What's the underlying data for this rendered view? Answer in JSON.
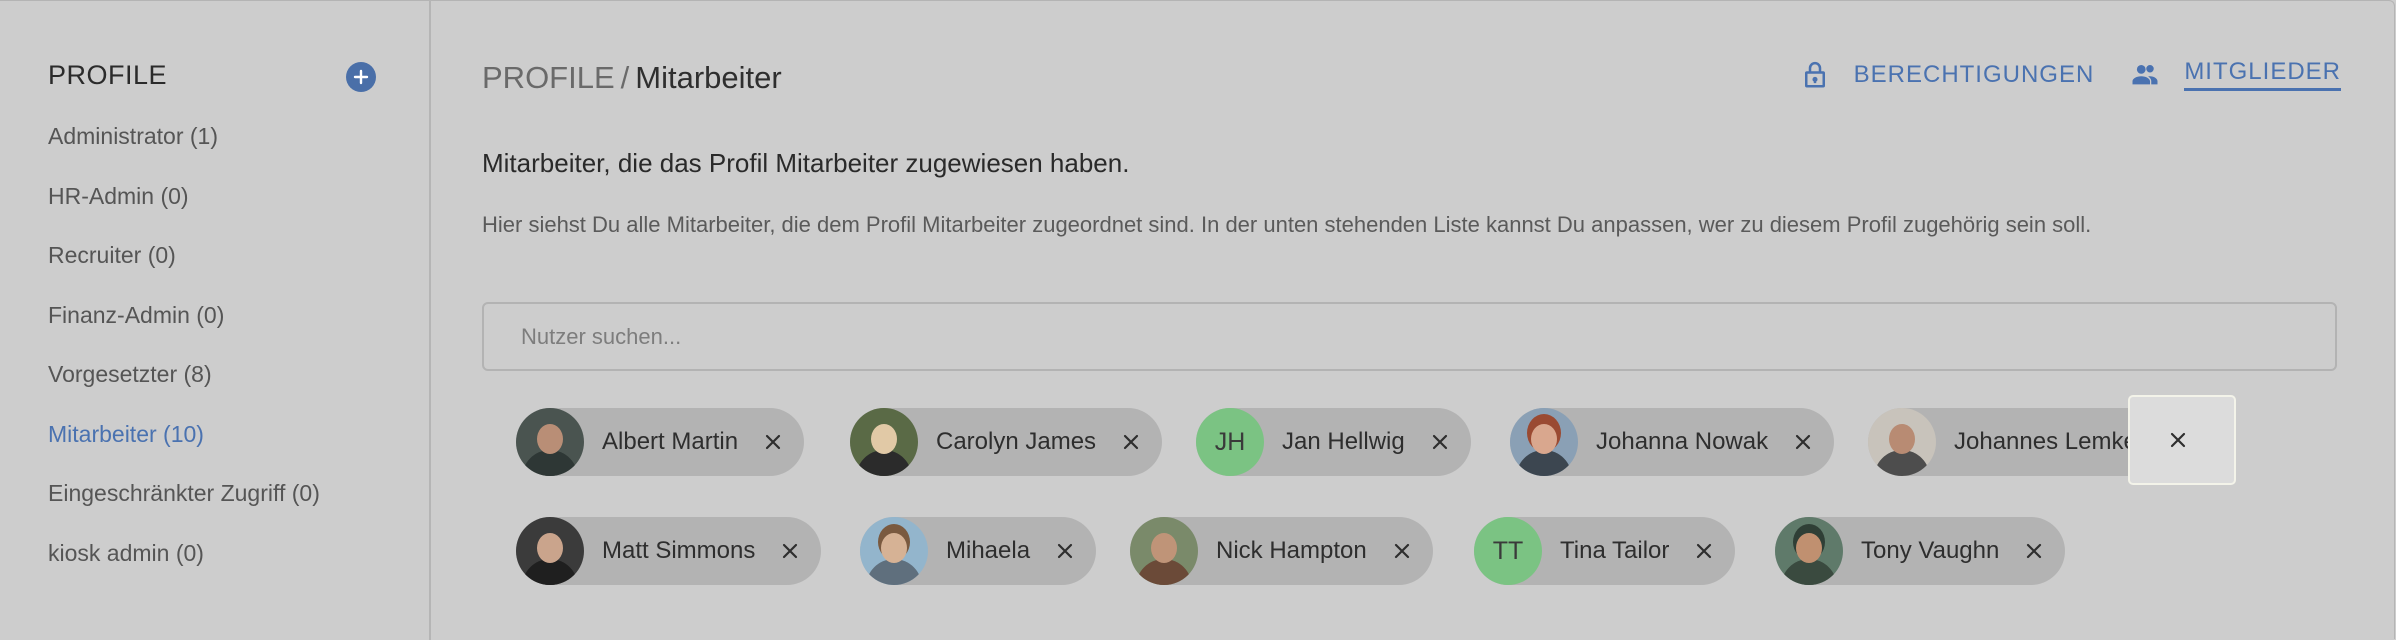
{
  "sidebar": {
    "title": "PROFILE",
    "items": [
      {
        "label": "Administrator (1)",
        "active": false
      },
      {
        "label": "HR-Admin (0)",
        "active": false
      },
      {
        "label": "Recruiter (0)",
        "active": false
      },
      {
        "label": "Finanz-Admin (0)",
        "active": false
      },
      {
        "label": "Vorgesetzter (8)",
        "active": false
      },
      {
        "label": "Mitarbeiter (10)",
        "active": true
      },
      {
        "label": "Eingeschränkter Zugriff (0)",
        "active": false
      },
      {
        "label": "kiosk admin (0)",
        "active": false
      }
    ]
  },
  "header": {
    "breadcrumb_root": "PROFILE",
    "breadcrumb_sep": "/",
    "breadcrumb_current": "Mitarbeiter",
    "permissions_label": "BERECHTIGUNGEN",
    "members_label": "MITGLIEDER"
  },
  "main": {
    "subtitle": "Mitarbeiter, die das Profil Mitarbeiter zugewiesen haben.",
    "description": "Hier siehst Du alle Mitarbeiter, die dem Profil Mitarbeiter zugeordnet sind. In der unten stehenden Liste kannst Du anpassen, wer zu diesem Profil zugehörig sein soll.",
    "search_placeholder": "Nutzer suchen..."
  },
  "members": [
    {
      "name": "Albert Martin",
      "avatar": "photo",
      "initials": ""
    },
    {
      "name": "Carolyn James",
      "avatar": "photo",
      "initials": ""
    },
    {
      "name": "Jan Hellwig",
      "avatar": "initials",
      "initials": "JH"
    },
    {
      "name": "Johanna Nowak",
      "avatar": "photo",
      "initials": ""
    },
    {
      "name": "Johannes Lemke",
      "avatar": "photo",
      "initials": ""
    },
    {
      "name": "Matt Simmons",
      "avatar": "photo",
      "initials": ""
    },
    {
      "name": "Mihaela",
      "avatar": "photo",
      "initials": ""
    },
    {
      "name": "Nick Hampton",
      "avatar": "photo",
      "initials": ""
    },
    {
      "name": "Tina Tailor",
      "avatar": "initials",
      "initials": "TT"
    },
    {
      "name": "Tony Vaughn",
      "avatar": "photo",
      "initials": ""
    }
  ],
  "colors": {
    "accent": "#4a72b0",
    "background": "#cdcdcd",
    "chip": "#b3b3b3",
    "initials_avatar": "#7bc383"
  },
  "icons": {
    "add": "plus-circle-icon",
    "permissions": "lock-icon",
    "members": "people-icon",
    "remove": "close-icon"
  }
}
